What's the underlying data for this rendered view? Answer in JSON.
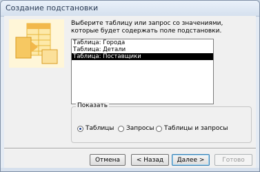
{
  "window": {
    "title": "Создание подстановки"
  },
  "instruction": "Выберите таблицу или запрос со значениями, которые будет содержать поле подстановки.",
  "list": {
    "items": [
      "Таблица: Города",
      "Таблица: Детали",
      "Таблица: Поставщики"
    ],
    "selected_index": 2
  },
  "show_group": {
    "label": "Показать",
    "options": [
      "Таблицы",
      "Запросы",
      "Таблицы и запросы"
    ],
    "selected": "Таблицы"
  },
  "buttons": {
    "cancel": "Отмена",
    "back": "< Назад",
    "next": "Далее >",
    "finish": "Готово"
  },
  "colors": {
    "selection_bg": "#000000",
    "window_frame": "#e4ebf4"
  }
}
